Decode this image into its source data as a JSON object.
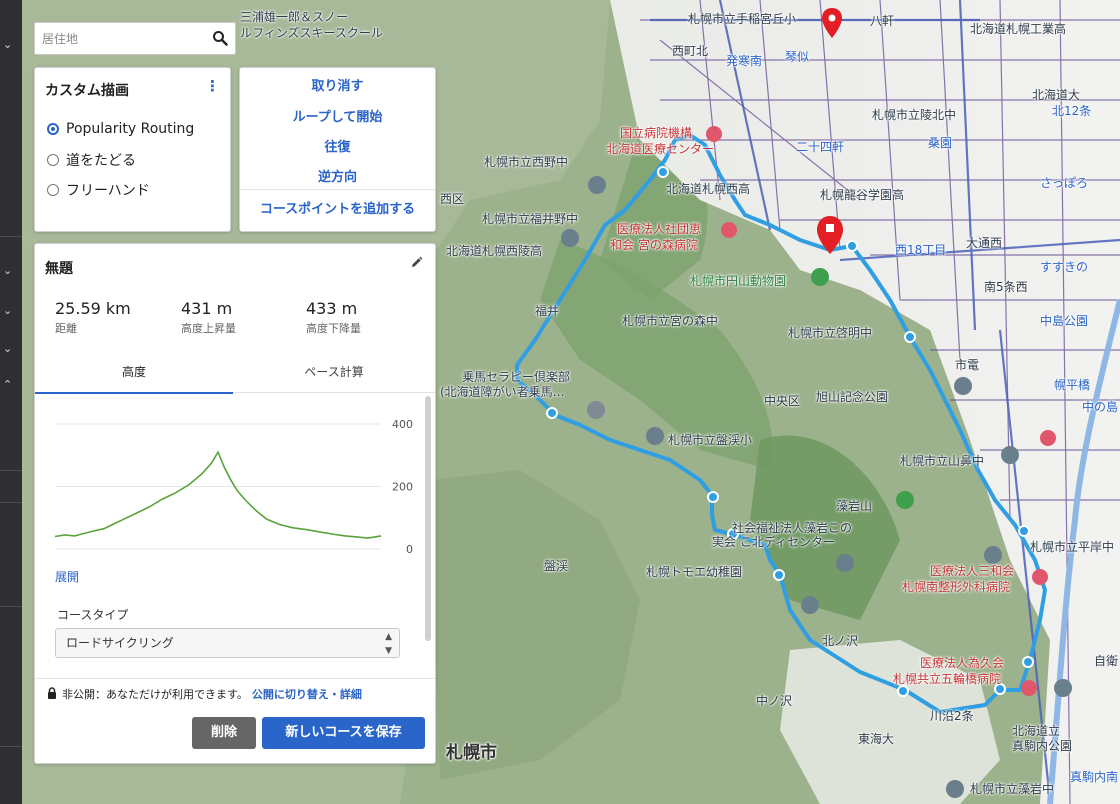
{
  "search": {
    "placeholder": "居住地"
  },
  "draw_panel": {
    "title": "カスタム描画",
    "modes": [
      {
        "label": "Popularity Routing",
        "selected": true
      },
      {
        "label": "道をたどる",
        "selected": false
      },
      {
        "label": "フリーハンド",
        "selected": false
      }
    ]
  },
  "actions": [
    "取り消す",
    "ループして開始",
    "往復",
    "逆方向",
    "コースポイントを追加する"
  ],
  "route": {
    "name": "無題",
    "stats": [
      {
        "value": "25.59 km",
        "label": "距離"
      },
      {
        "value": "431 m",
        "label": "高度上昇量"
      },
      {
        "value": "433 m",
        "label": "高度下降量"
      }
    ],
    "tabs": [
      "高度",
      "ペース計算"
    ],
    "active_tab": "高度",
    "expand_label": "展開",
    "course_type_label": "コースタイプ",
    "course_type_value": "ロードサイクリング",
    "privacy_text": "非公開：あなただけが利用できます。",
    "privacy_link": "公開に切り替え・詳細",
    "delete_label": "削除",
    "save_label": "新しいコースを保存"
  },
  "chart_data": {
    "type": "area",
    "yticks": [
      "400",
      "200",
      "0"
    ],
    "ylim": [
      0,
      400
    ],
    "color": "#5aa33c",
    "x": [
      0,
      0.03,
      0.06,
      0.09,
      0.12,
      0.15,
      0.18,
      0.21,
      0.25,
      0.29,
      0.33,
      0.37,
      0.41,
      0.45,
      0.48,
      0.5,
      0.52,
      0.54,
      0.56,
      0.59,
      0.62,
      0.65,
      0.69,
      0.73,
      0.77,
      0.81,
      0.85,
      0.89,
      0.93,
      0.96,
      1.0
    ],
    "values": [
      40,
      45,
      42,
      50,
      58,
      65,
      80,
      95,
      115,
      135,
      160,
      180,
      205,
      240,
      275,
      310,
      260,
      220,
      185,
      150,
      120,
      95,
      78,
      68,
      62,
      55,
      48,
      42,
      38,
      35,
      42
    ]
  },
  "map": {
    "labels": [
      "札幌市立手稲宮丘小",
      "八軒",
      "北海道札幌工業高",
      "西町北",
      "発寒南",
      "琴似",
      "札幌市立陵北中",
      "北12条",
      "北海道大",
      "国立病院機構",
      "北海道医療センター",
      "二十四軒",
      "桑園",
      "札幌市立西野中",
      "北海道札幌西高",
      "札幌龍谷学園高",
      "さっぽろ",
      "医療法人社団恵",
      "和会 宮の森病院",
      "西18丁目",
      "大通西",
      "札幌市立福井野中",
      "北海道札幌西陵高",
      "札幌市円山動物園",
      "すすきの",
      "南5条西",
      "福井",
      "札幌市立宮の森中",
      "札幌市立啓明中",
      "中島公園",
      "乗馬セラピー倶楽部",
      "(北海道障がい者乗馬…",
      "旭山記念公園",
      "中央区",
      "札幌市立盤渓小",
      "幌平橋",
      "札幌市立山鼻中",
      "藻岩山",
      "社会福祉法人藻岩この",
      "実会 こ北ディセンター",
      "盤渓",
      "札幌トモエ幼稚園",
      "札幌市立平岸中",
      "医療法人三和会",
      "札幌南整形外科病院",
      "北ノ沢",
      "医療法人為久会",
      "札幌共立五輪橋病院",
      "中ノ沢",
      "川沿2条",
      "東海大",
      "北海道立",
      "真駒内公園",
      "札幌市",
      "札幌市立藻岩中",
      "真駒内南",
      "自衛",
      "中の島",
      "西区",
      "三浦雄一郎＆スノー",
      "ルフィンズスキースクール",
      "市電"
    ]
  }
}
